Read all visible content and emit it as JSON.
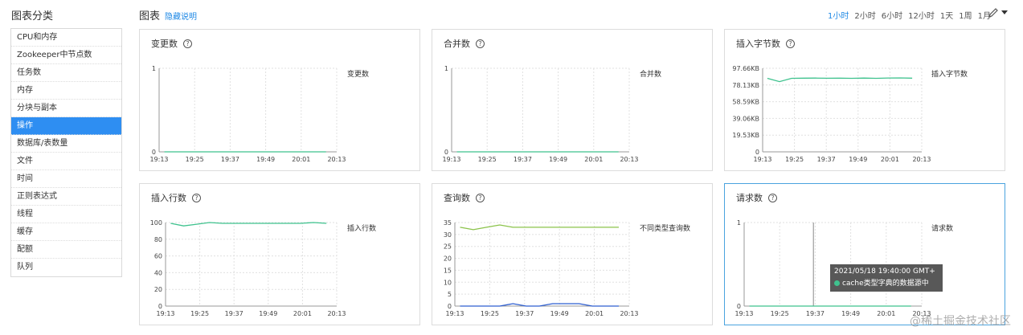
{
  "sidebar": {
    "title": "图表分类",
    "items": [
      {
        "label": "CPU和内存"
      },
      {
        "label": "Zookeeper中节点数"
      },
      {
        "label": "任务数"
      },
      {
        "label": "内存"
      },
      {
        "label": "分块与副本"
      },
      {
        "label": "操作",
        "active": true
      },
      {
        "label": "数据库/表数量"
      },
      {
        "label": "文件"
      },
      {
        "label": "时间"
      },
      {
        "label": "正则表达式"
      },
      {
        "label": "线程"
      },
      {
        "label": "缓存"
      },
      {
        "label": "配额"
      },
      {
        "label": "队列"
      }
    ]
  },
  "header": {
    "title": "图表",
    "hide_link": "隐藏说明",
    "time_ranges": [
      "1小时",
      "2小时",
      "6小时",
      "12小时",
      "1天",
      "1周",
      "1月"
    ],
    "active_range": "1小时",
    "edit_icon": "pencil-icon",
    "dropdown_icon": "caret-down-icon"
  },
  "colors": {
    "accent": "#2e8ef2",
    "series_green": "#3fc28e",
    "series_lime": "#8bc34a",
    "series_blue": "#2f5fd0"
  },
  "chart_data": [
    {
      "type": "line",
      "title": "变更数",
      "x": [
        "19:13",
        "19:25",
        "19:37",
        "19:49",
        "20:01",
        "20:13"
      ],
      "yticks": [
        "1",
        "0"
      ],
      "ylim": [
        0,
        1
      ],
      "series": [
        {
          "name": "变更数",
          "color": "#3fc28e",
          "values": [
            0,
            0,
            0,
            0,
            0,
            0
          ]
        }
      ]
    },
    {
      "type": "line",
      "title": "合并数",
      "x": [
        "19:13",
        "19:25",
        "19:37",
        "19:49",
        "20:01",
        "20:13"
      ],
      "yticks": [
        "1",
        "0"
      ],
      "ylim": [
        0,
        1
      ],
      "series": [
        {
          "name": "合并数",
          "color": "#3fc28e",
          "values": [
            0,
            0,
            0,
            0,
            0,
            0
          ]
        }
      ]
    },
    {
      "type": "line",
      "title": "插入字节数",
      "x": [
        "19:13",
        "19:25",
        "19:37",
        "19:49",
        "20:01",
        "20:13"
      ],
      "yticks": [
        "97.66KB",
        "78.13KB",
        "58.59KB",
        "39.06KB",
        "19.53KB",
        "0"
      ],
      "ylim": [
        0,
        100000
      ],
      "series": [
        {
          "name": "插入字节数",
          "color": "#3fc28e",
          "values": [
            88000,
            84000,
            88000,
            88200,
            88300,
            88100,
            88200,
            88000,
            88300,
            88000,
            88400,
            88500,
            88200
          ]
        }
      ]
    },
    {
      "type": "line",
      "title": "插入行数",
      "x": [
        "19:13",
        "19:25",
        "19:37",
        "19:49",
        "20:01",
        "20:13"
      ],
      "yticks": [
        "100",
        "80",
        "60",
        "40",
        "20",
        "0"
      ],
      "ylim": [
        0,
        100
      ],
      "series": [
        {
          "name": "插入行数",
          "color": "#3fc28e",
          "values": [
            99,
            96,
            98,
            100,
            99,
            99,
            99,
            99,
            99,
            99,
            99,
            100,
            99
          ]
        }
      ]
    },
    {
      "type": "line",
      "title": "查询数",
      "x": [
        "19:13",
        "19:25",
        "19:37",
        "19:49",
        "20:01",
        "20:13"
      ],
      "yticks": [
        "35",
        "30",
        "25",
        "20",
        "15",
        "10",
        "5",
        "0"
      ],
      "ylim": [
        0,
        35
      ],
      "series": [
        {
          "name": "不同类型查询数",
          "color": "#8bc34a",
          "values": [
            33,
            32,
            33,
            34,
            33,
            33,
            33,
            33,
            33,
            33,
            33,
            33,
            33
          ]
        },
        {
          "color": "#2f5fd0",
          "values": [
            0,
            0,
            0,
            0,
            1,
            0,
            0,
            1,
            1,
            1,
            0,
            0,
            0
          ]
        }
      ]
    },
    {
      "type": "line",
      "title": "请求数",
      "x": [
        "19:13",
        "19:25",
        "19:37",
        "19:49",
        "20:01",
        "20:13"
      ],
      "yticks": [
        "1",
        "0"
      ],
      "ylim": [
        0,
        1
      ],
      "series": [
        {
          "name": "请求数",
          "color": "#3fc28e",
          "values": [
            0,
            0,
            0,
            0,
            0,
            0,
            0,
            0,
            0,
            0,
            0,
            0
          ]
        }
      ],
      "tooltip": {
        "time": "2021/05/18 19:40:00 GMT+",
        "series": "cache类型字典的数据源中"
      }
    }
  ],
  "watermark": "@稀土掘金技术社区"
}
